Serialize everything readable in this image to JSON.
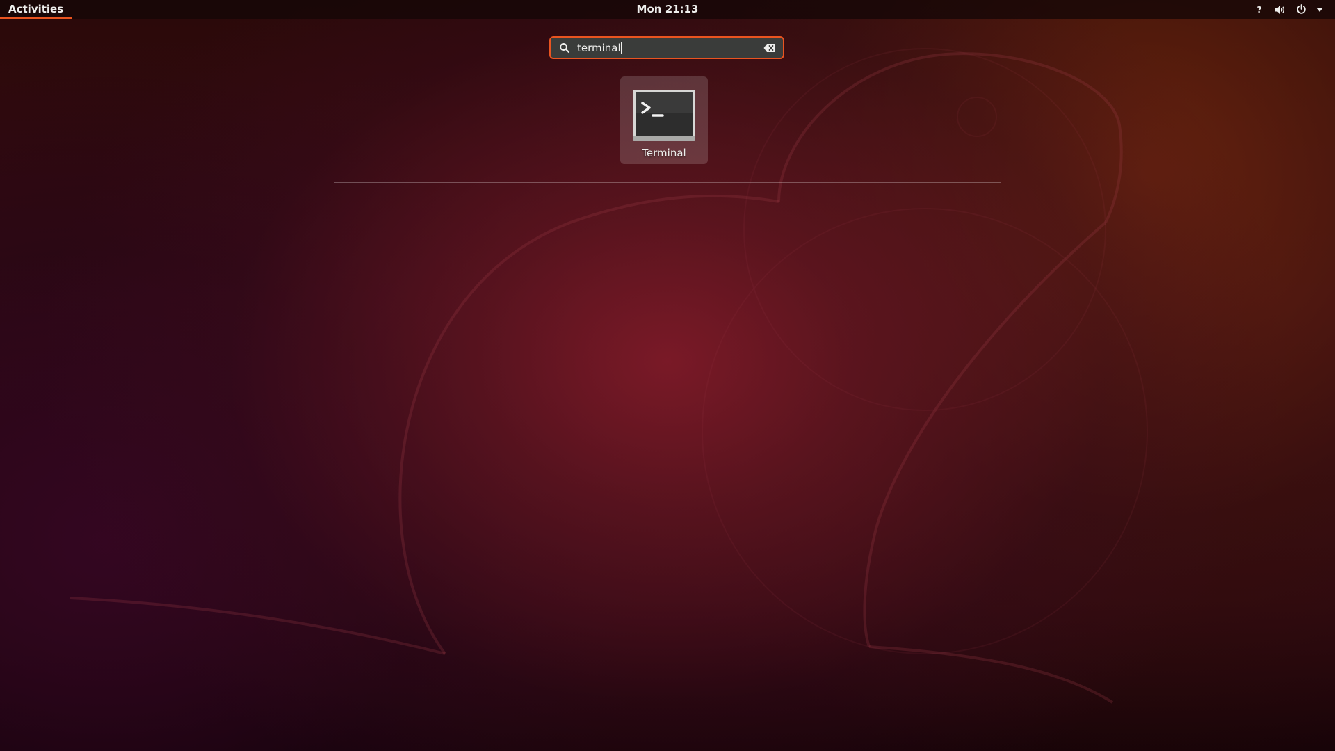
{
  "topbar": {
    "activities_label": "Activities",
    "clock": "Mon 21:13",
    "tray_icons": [
      "help-icon",
      "volume-icon",
      "power-icon",
      "chevron-down-icon"
    ],
    "help_glyph": "?",
    "accent_color": "#e95420"
  },
  "search": {
    "value": "terminal",
    "icons": [
      "search-icon",
      "clear-icon"
    ]
  },
  "results": [
    {
      "label": "Terminal",
      "icon": "terminal-icon"
    }
  ]
}
